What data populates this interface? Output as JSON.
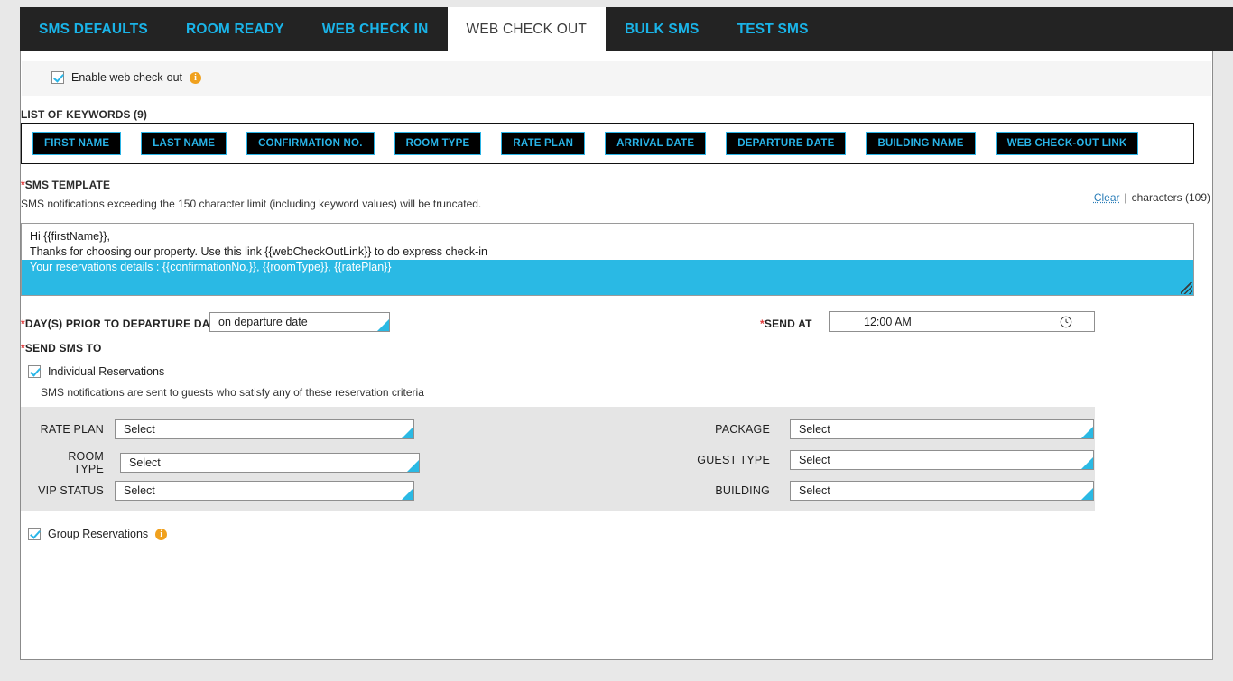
{
  "tabs": [
    {
      "label": "SMS DEFAULTS",
      "active": false
    },
    {
      "label": "ROOM READY",
      "active": false
    },
    {
      "label": "WEB CHECK IN",
      "active": false
    },
    {
      "label": "WEB CHECK OUT",
      "active": true
    },
    {
      "label": "BULK SMS",
      "active": false
    },
    {
      "label": "TEST SMS",
      "active": false
    }
  ],
  "enable": {
    "label": "Enable web check-out",
    "checked": true,
    "info_icon": "info-icon"
  },
  "keywords": {
    "heading": "LIST OF KEYWORDS (9)",
    "items": [
      "FIRST NAME",
      "LAST NAME",
      "CONFIRMATION NO.",
      "ROOM TYPE",
      "RATE PLAN",
      "ARRIVAL DATE",
      "DEPARTURE DATE",
      "BUILDING NAME",
      "WEB CHECK-OUT LINK"
    ]
  },
  "sms_template": {
    "label_star": "*",
    "label": "SMS TEMPLATE",
    "hint": "SMS notifications exceeding the 150 character limit (including keyword values) will be truncated.",
    "clear_label": "Clear",
    "separator": "|",
    "character_count": "characters (109)",
    "lines": [
      "Hi {{firstName}},",
      "Thanks for choosing our property. Use this link {{webCheckOutLink}} to do express check-in"
    ],
    "selected_line": "Your reservations details : {{confirmationNo.}}, {{roomType}}, {{ratePlan}}",
    "selection_color": "#2ab9e4"
  },
  "schedule": {
    "days_prior_star": "*",
    "days_prior_label": "DAY(S) PRIOR TO DEPARTURE DATE",
    "days_prior_value": "on departure date",
    "send_at_star": "*",
    "send_at_label": "SEND AT",
    "send_at_value": "12:00 AM",
    "clock_icon": "clock-icon"
  },
  "send_sms_to": {
    "star": "*",
    "label": "SEND SMS TO",
    "individual": {
      "label": "Individual Reservations",
      "checked": true,
      "description": "SMS notifications are sent to guests who satisfy any of these reservation criteria"
    },
    "group": {
      "label": "Group Reservations",
      "checked": true,
      "info_icon": "info-icon"
    }
  },
  "criteria": {
    "left": [
      {
        "label": "RATE PLAN",
        "value": "Select"
      },
      {
        "label": "ROOM TYPE",
        "value": "Select"
      },
      {
        "label": "VIP STATUS",
        "value": "Select"
      }
    ],
    "right": [
      {
        "label": "PACKAGE",
        "value": "Select"
      },
      {
        "label": "GUEST TYPE",
        "value": "Select"
      },
      {
        "label": "BUILDING",
        "value": "Select"
      }
    ]
  },
  "colors": {
    "accent": "#29b4e8",
    "tabbar_bg": "#232323",
    "required": "#e03b3b",
    "info": "#f0a11e",
    "panel_grey": "#e5e5e5"
  }
}
